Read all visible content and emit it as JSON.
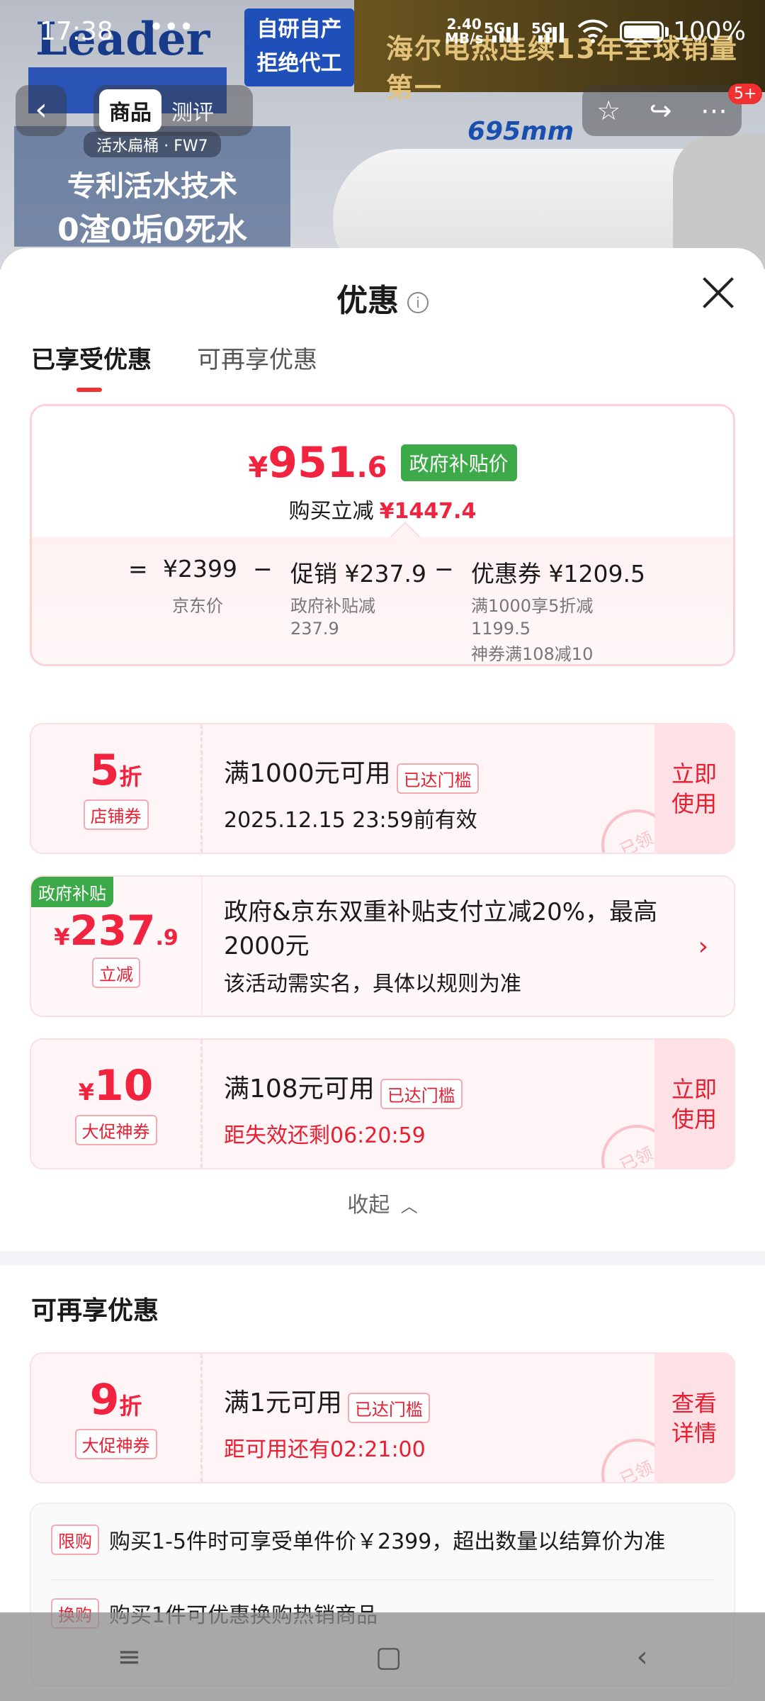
{
  "status_bar": {
    "time": "17:38",
    "dots": "•••",
    "net_speed_value": "2.40",
    "net_speed_unit": "MB/s",
    "sim1": "5G",
    "sim2": "5G",
    "battery": "100%"
  },
  "banner": {
    "brand": "Leader",
    "badge_line1": "自研自产",
    "badge_line2": "拒绝代工",
    "gold_text": "海尔电热连续13年全球销量第一",
    "patent_sub": "活水扁桶 · FW7",
    "patent_line1": "专利活水技术",
    "patent_line2": "0渣0垢0死水",
    "dimension": "695mm"
  },
  "top_nav": {
    "tabs": [
      "商品",
      "测评"
    ],
    "badge": "5+"
  },
  "sheet": {
    "title": "优惠",
    "tabs": [
      "已享受优惠",
      "可再享优惠"
    ],
    "summary": {
      "price_currency": "¥",
      "price_int": "951",
      "price_dec": ".6",
      "gov_tag": "政府补贴价",
      "instant_label": "购买立减",
      "instant_value": "¥1447.4",
      "formula": {
        "eq": "=",
        "jd_price": "¥2399",
        "minus1": "−",
        "promo": "促销 ¥237.9",
        "minus2": "−",
        "coupon": "优惠券 ¥1209.5",
        "jd_price_label": "京东价",
        "promo_sub_1": "政府补贴减",
        "promo_sub_2": "237.9",
        "coupon_sub_1": "满1000享5折减",
        "coupon_sub_2": "1199.5",
        "coupon_sub_3": "神券满108减10"
      }
    },
    "coupons": [
      {
        "value": "5",
        "unit": "折",
        "type": "店铺券",
        "title": "满1000元可用",
        "badge": "已达门槛",
        "subtitle": "2025.12.15 23:59前有效",
        "action": "立即使用",
        "stamp": "已领"
      },
      {
        "value": "10",
        "currency": "¥",
        "type": "大促神券",
        "title": "满108元可用",
        "badge": "已达门槛",
        "subtitle": "距失效还剩06:20:59",
        "action": "立即使用",
        "stamp": "已领"
      }
    ],
    "gov_subsidy": {
      "flag": "政府补贴",
      "currency": "¥",
      "value_int": "237",
      "value_dec": ".9",
      "type": "立减",
      "title": "政府&京东双重补贴支付立减20%，最高2000元",
      "subtitle": "该活动需实名，具体以规则为准"
    },
    "collapse_label": "收起",
    "more_section_title": "可再享优惠",
    "more_coupon": {
      "value": "9",
      "unit": "折",
      "type": "大促神券",
      "title": "满1元可用",
      "badge": "已达门槛",
      "subtitle": "距可用还有02:21:00",
      "action": "查看详情",
      "stamp": "已领"
    },
    "limits": [
      {
        "tag": "限购",
        "text": "购买1-5件时可享受单件价￥2399，超出数量以结算价为准"
      },
      {
        "tag": "换购",
        "text": "购买1件可优惠换购热销商品"
      }
    ]
  },
  "colors": {
    "accent_red": "#f2233f",
    "gov_green": "#3daa49",
    "coupon_bg": "#fff5f6"
  }
}
